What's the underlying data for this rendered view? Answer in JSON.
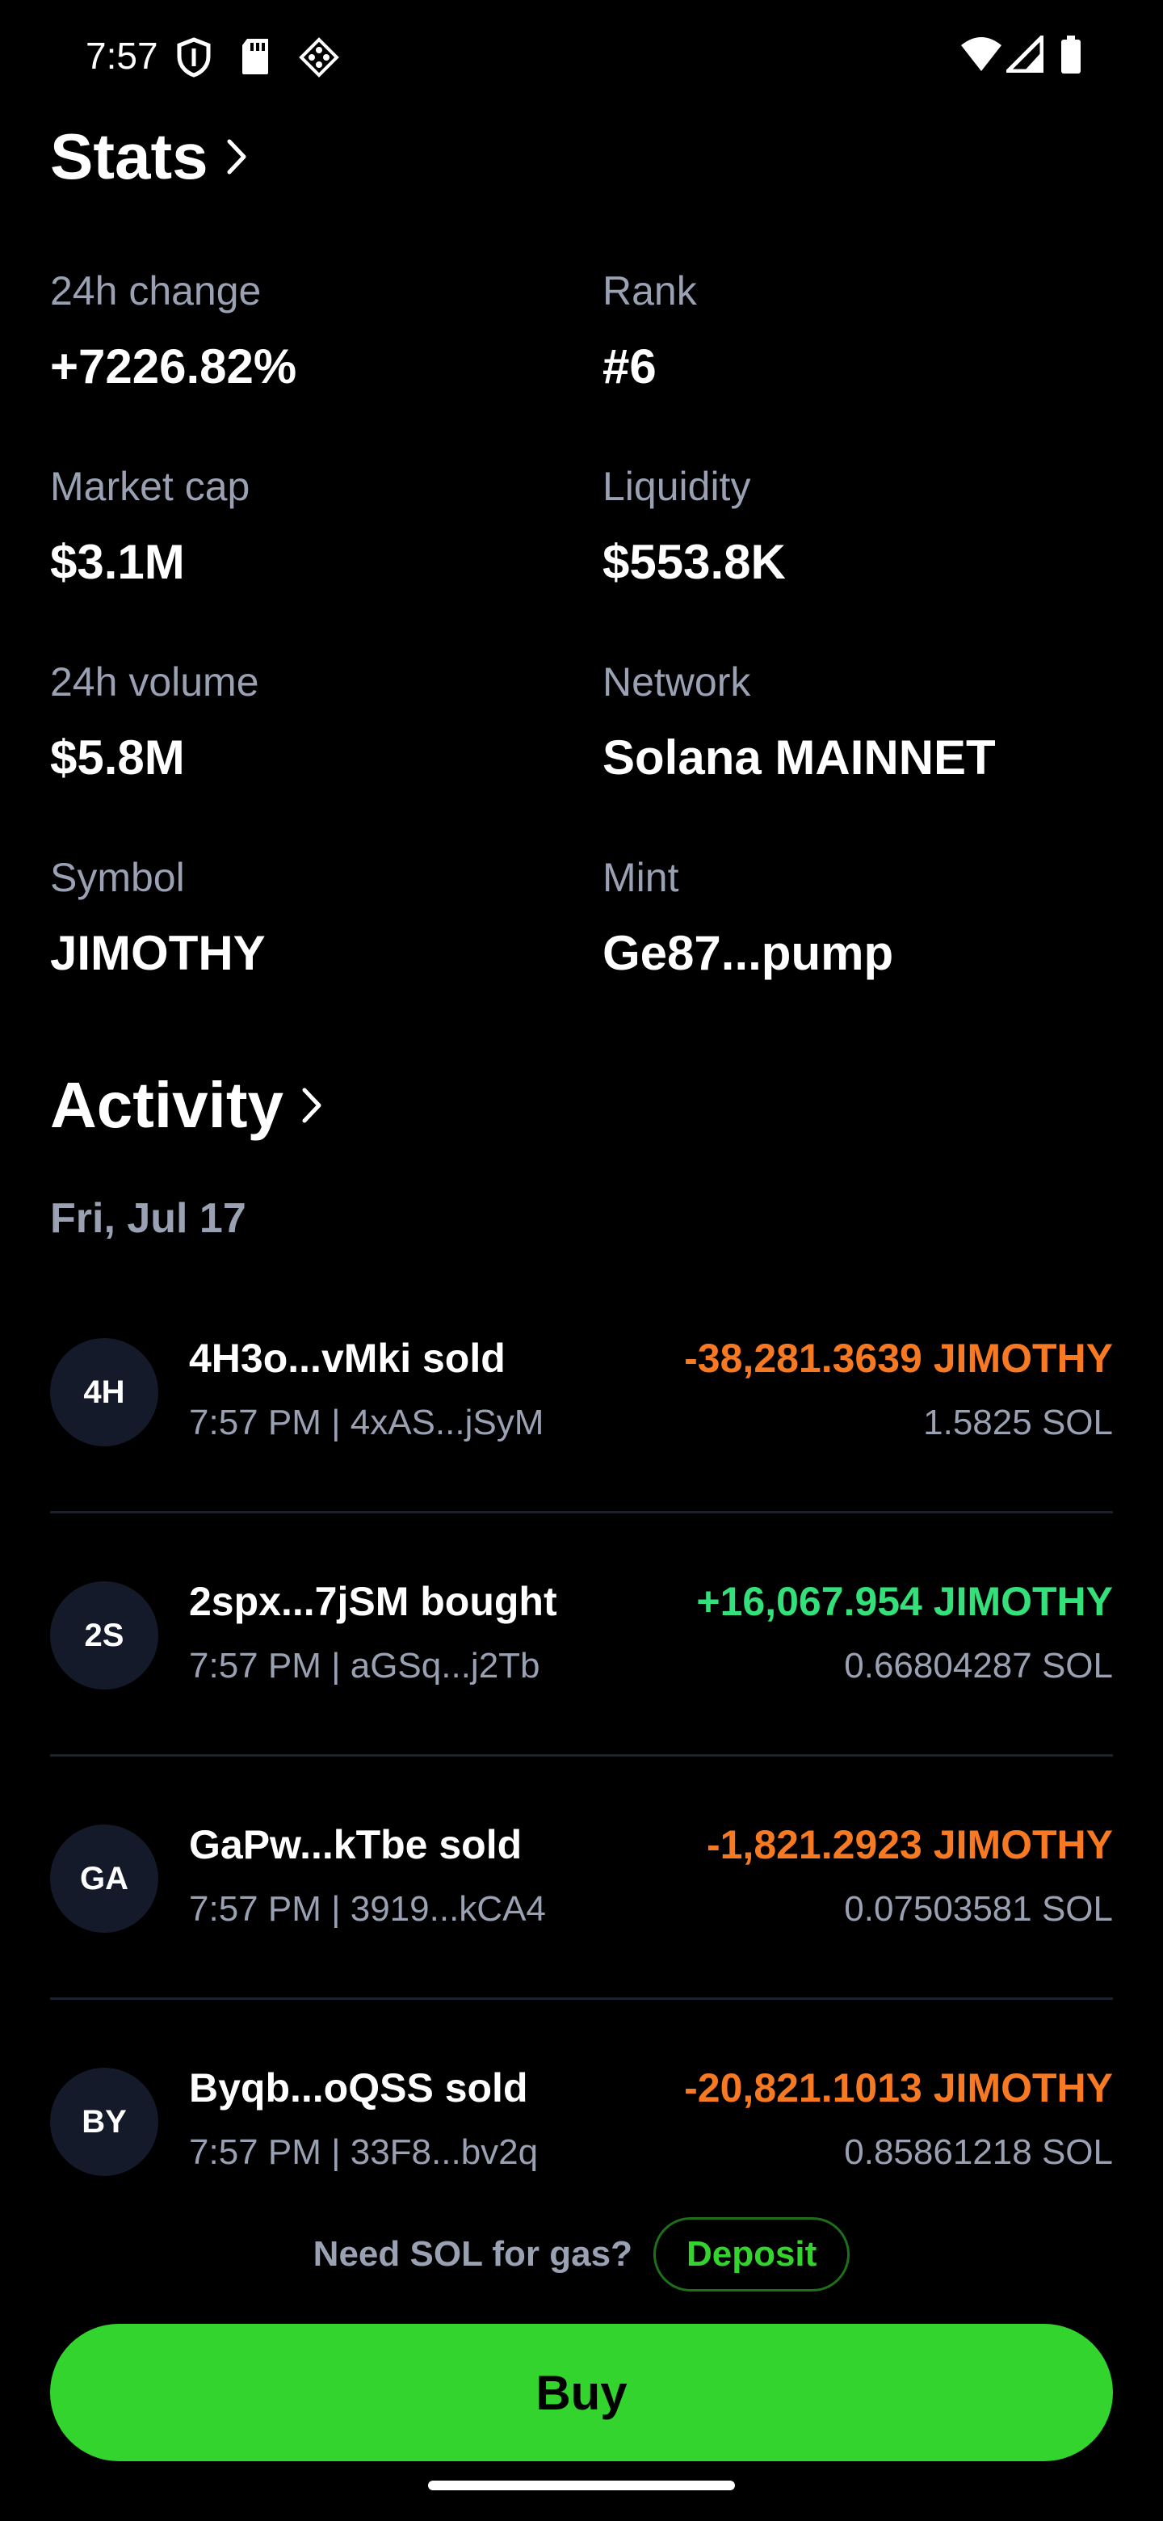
{
  "status_bar": {
    "time": "7:57",
    "icons_left": [
      "shield-icon",
      "sd-card-icon",
      "diamond-app-icon"
    ],
    "icons_right": [
      "wifi-icon",
      "signal-icon",
      "battery-icon"
    ]
  },
  "stats": {
    "title": "Stats",
    "items": [
      {
        "label": "24h change",
        "value": "+7226.82%"
      },
      {
        "label": "Rank",
        "value": "#6"
      },
      {
        "label": "Market cap",
        "value": "$3.1M"
      },
      {
        "label": "Liquidity",
        "value": "$553.8K"
      },
      {
        "label": "24h volume",
        "value": "$5.8M"
      },
      {
        "label": "Network",
        "value": "Solana MAINNET"
      },
      {
        "label": "Symbol",
        "value": "JIMOTHY"
      },
      {
        "label": "Mint",
        "value": "Ge87...pump"
      }
    ]
  },
  "activity": {
    "title": "Activity",
    "date": "Fri, Jul 17",
    "rows": [
      {
        "initials": "4H",
        "title": "4H3o...vMki sold",
        "sub": "7:57 PM | 4xAS...jSyM",
        "amount": "-38,281.3639 JIMOTHY",
        "sol": "1.5825 SOL",
        "type": "sell"
      },
      {
        "initials": "2S",
        "title": "2spx...7jSM bought",
        "sub": "7:57 PM | aGSq...j2Tb",
        "amount": "+16,067.954 JIMOTHY",
        "sol": "0.66804287 SOL",
        "type": "buy"
      },
      {
        "initials": "GA",
        "title": "GaPw...kTbe sold",
        "sub": "7:57 PM | 3919...kCA4",
        "amount": "-1,821.2923 JIMOTHY",
        "sol": "0.07503581 SOL",
        "type": "sell"
      },
      {
        "initials": "BY",
        "title": "Byqb...oQSS sold",
        "sub": "7:57 PM | 33F8...bv2q",
        "amount": "-20,821.1013 JIMOTHY",
        "sol": "0.85861218 SOL",
        "type": "sell"
      }
    ]
  },
  "footer": {
    "gas_text": "Need SOL for gas?",
    "deposit_label": "Deposit",
    "buy_label": "Buy"
  },
  "colors": {
    "background": "#000000",
    "muted_text": "#99a1b3",
    "sell": "#f77a22",
    "buy": "#33e07a",
    "accent_green": "#33d42d",
    "avatar_bg": "#141a2a"
  }
}
